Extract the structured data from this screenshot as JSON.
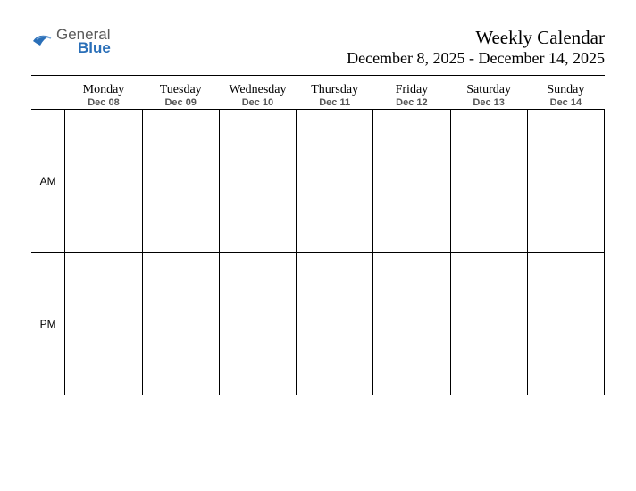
{
  "logo": {
    "text1": "General",
    "text2": "Blue"
  },
  "title": "Weekly Calendar",
  "date_range": "December 8, 2025 - December 14, 2025",
  "periods": [
    "AM",
    "PM"
  ],
  "days": [
    {
      "name": "Monday",
      "date": "Dec 08"
    },
    {
      "name": "Tuesday",
      "date": "Dec 09"
    },
    {
      "name": "Wednesday",
      "date": "Dec 10"
    },
    {
      "name": "Thursday",
      "date": "Dec 11"
    },
    {
      "name": "Friday",
      "date": "Dec 12"
    },
    {
      "name": "Saturday",
      "date": "Dec 13"
    },
    {
      "name": "Sunday",
      "date": "Dec 14"
    }
  ]
}
